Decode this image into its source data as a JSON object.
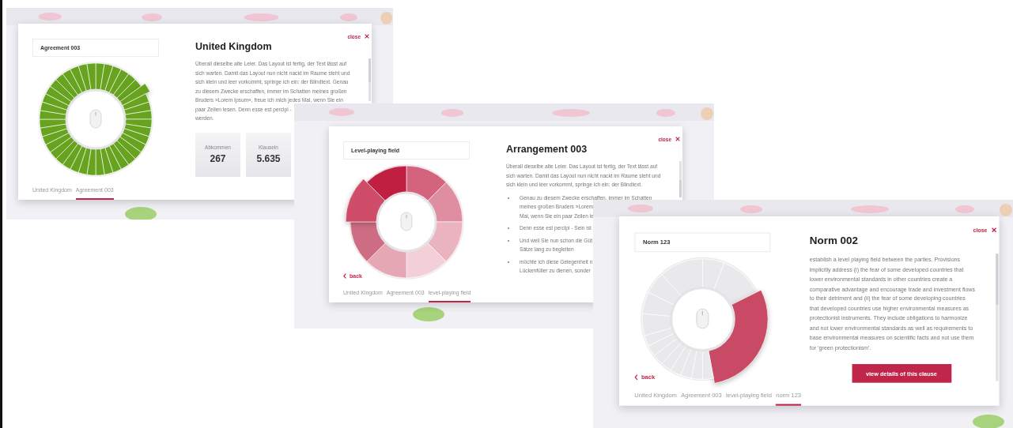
{
  "panels": [
    {
      "label": "Agreement 003",
      "close": "close",
      "title": "United Kingdom",
      "wheel": {
        "color": "#67a31f",
        "segments": [
          {
            "selected": false
          },
          {
            "selected": false
          },
          {
            "selected": false
          },
          {
            "selected": false
          },
          {
            "selected": false
          },
          {
            "selected": false
          },
          {
            "selected": true
          },
          {
            "selected": false
          },
          {
            "selected": false
          },
          {
            "selected": false
          },
          {
            "selected": false
          },
          {
            "selected": false
          },
          {
            "selected": false
          },
          {
            "selected": false
          },
          {
            "selected": false
          },
          {
            "selected": false
          },
          {
            "selected": false
          },
          {
            "selected": false
          },
          {
            "selected": false
          },
          {
            "selected": false
          },
          {
            "selected": false
          },
          {
            "selected": false
          },
          {
            "selected": false
          },
          {
            "selected": false
          },
          {
            "selected": false
          },
          {
            "selected": false
          },
          {
            "selected": false
          },
          {
            "selected": false
          },
          {
            "selected": false
          },
          {
            "selected": false
          },
          {
            "selected": false
          },
          {
            "selected": false
          },
          {
            "selected": false
          },
          {
            "selected": false
          },
          {
            "selected": false
          },
          {
            "selected": false
          },
          {
            "selected": false
          },
          {
            "selected": false
          },
          {
            "selected": false
          },
          {
            "selected": false
          }
        ]
      },
      "text_lines": [
        "Überall dieselbe alte Leier. Das Layout ist fertig, der Text lässt auf",
        "sich warten. Damit das Layout nun nicht nackt im Raume steht und",
        "sich klein und leer vorkommt, springe ich ein: der Blindtext. Genau",
        "zu diesem Zwecke erschaffen, immer im Schatten meines großen",
        "Bruders »Lorem Ipsum«, freue ich mich jedes Mal, wenn Sie ein",
        "paar Zeilen lesen. Denn esse est percipi -",
        "werden."
      ],
      "stats": [
        {
          "label": "Abkommen",
          "value": "267"
        },
        {
          "label": "Klauseln",
          "value": "5.635"
        }
      ],
      "breadcrumbs": [
        {
          "label": "United Kingdom",
          "selected": false
        },
        {
          "label": "Agreement 003",
          "selected": true
        }
      ]
    },
    {
      "label": "Level-playing field",
      "close": "close",
      "title": "Arrangement 003",
      "back": "back",
      "wheel": {
        "segments": [
          {
            "color": "#d4637e",
            "selected": false
          },
          {
            "color": "#df8da0",
            "selected": false
          },
          {
            "color": "#ebb3c0",
            "selected": false
          },
          {
            "color": "#f3d0d8",
            "selected": false
          },
          {
            "color": "#e6a7b5",
            "selected": false
          },
          {
            "color": "#cd6c83",
            "selected": false
          },
          {
            "color": "#cf4d69",
            "selected": true
          },
          {
            "color": "#c01f41",
            "selected": false
          }
        ]
      },
      "text_lines": [
        "Überall dieselbe alte Leier. Das Layout ist fertig, der Text lässt auf",
        "sich warten. Damit das Layout nun nicht nackt im Raume steht und",
        "sich klein und leer vorkommt, springe ich ein: der Blindtext."
      ],
      "bullets": [
        {
          "lines": [
            "Genau zu diesem Zwecke erschaffen, immer im Schatten",
            "meines großen Bruders »Lorem",
            "Mal, wenn Sie ein paar Zeilen le"
          ]
        },
        {
          "lines": [
            "Denn esse est percipi - Sein ist"
          ]
        },
        {
          "lines": [
            "Und weil Sie nun schon die Güt",
            "Sätze lang zu begleiten"
          ]
        },
        {
          "lines": [
            "möchte ich diese Gelegenheit n",
            "Lückenfüller zu dienen, sonder"
          ]
        }
      ],
      "breadcrumbs": [
        {
          "label": "United Kingdom",
          "selected": false
        },
        {
          "label": "Agreement 003",
          "selected": false
        },
        {
          "label": "level-playing field",
          "selected": true
        }
      ]
    },
    {
      "label": "Norm 123",
      "close": "close",
      "title": "Norm 002",
      "back": "back",
      "wheel": {
        "color": "#e9e9eb",
        "segments": [
          {
            "kind": "mid",
            "selected": false
          },
          {
            "kind": "wide",
            "selected": false
          },
          {
            "kind": "large",
            "selected": true,
            "color": "#c94a65"
          },
          {
            "kind": "narrow",
            "selected": false
          },
          {
            "kind": "narrow",
            "selected": false
          },
          {
            "kind": "narrow",
            "selected": false
          },
          {
            "kind": "narrow",
            "selected": false
          },
          {
            "kind": "narrow",
            "selected": false
          },
          {
            "kind": "narrow",
            "selected": false
          },
          {
            "kind": "narrow",
            "selected": false
          },
          {
            "kind": "narrow",
            "selected": false
          },
          {
            "kind": "mid",
            "selected": false
          },
          {
            "kind": "mid",
            "selected": false
          },
          {
            "kind": "mid",
            "selected": false
          },
          {
            "kind": "wide",
            "selected": false
          }
        ]
      },
      "text_lines": [
        "establish a level playing field between the parties. Provisions",
        "implicitly address (i) the fear of some developed countries that",
        "lower environmental standards in other countries create a",
        "comparative advantage and encourage trade and investment flows",
        "to their detriment and (ii) the fear of some developing countries",
        "that developed countries use higher environmental measures as",
        "protectionist instruments. They include obligations to harmonize",
        "and not lower environmental standards as well as requirements to",
        "base environmental measures on scientific facts and not use them",
        "for ‘green protectionism’."
      ],
      "button": "view details of this clause",
      "breadcrumbs": [
        {
          "label": "United Kingdom",
          "selected": false
        },
        {
          "label": "Agreement 003",
          "selected": false
        },
        {
          "label": "level-playing field",
          "selected": false
        },
        {
          "label": "norm 123",
          "selected": true
        }
      ]
    }
  ]
}
